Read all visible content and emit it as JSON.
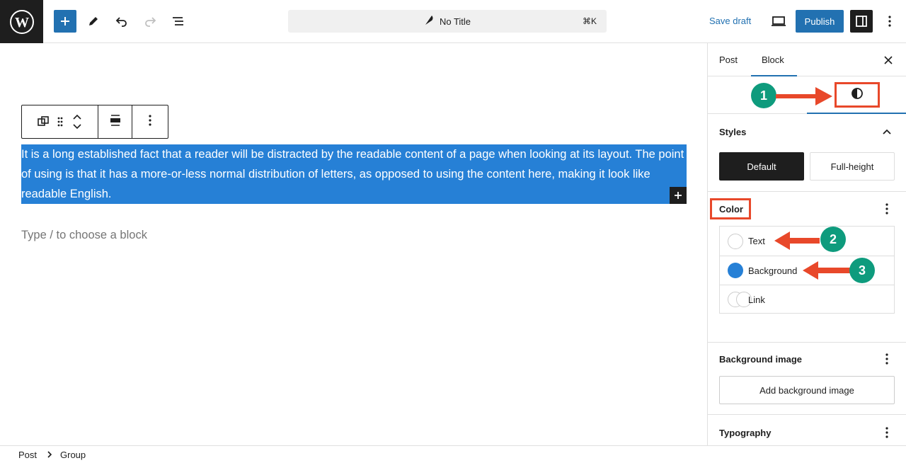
{
  "header": {
    "document_title": "No Title",
    "shortcut": "⌘K",
    "save_draft": "Save draft",
    "publish": "Publish"
  },
  "editor": {
    "paragraph_text": "It is a long established fact that a reader will be distracted by the readable content of a page when looking at its layout. The point of using is that it has a more-or-less normal distribution of letters, as opposed to using the content here, making it look like readable English.",
    "placeholder": "Type / to choose a block",
    "selection_color": "#2680d6"
  },
  "sidebar": {
    "tabs": [
      {
        "label": "Post",
        "active": false
      },
      {
        "label": "Block",
        "active": true
      }
    ],
    "styles": {
      "title": "Styles",
      "options": [
        "Default",
        "Full-height"
      ],
      "selected": "Default"
    },
    "color": {
      "title": "Color",
      "items": [
        {
          "label": "Text",
          "swatch": "empty"
        },
        {
          "label": "Background",
          "swatch": "#2680d6"
        },
        {
          "label": "Link",
          "swatch": "empty"
        }
      ]
    },
    "background_image": {
      "title": "Background image",
      "button": "Add background image"
    },
    "typography": {
      "title": "Typography"
    }
  },
  "annotations": {
    "markers": [
      "1",
      "2",
      "3"
    ],
    "arrow_color": "#e8482a",
    "marker_color": "#0e9b7d"
  },
  "breadcrumb": [
    "Post",
    "Group"
  ],
  "colors": {
    "accent": "#2271b1",
    "dark": "#1e1e1e"
  }
}
